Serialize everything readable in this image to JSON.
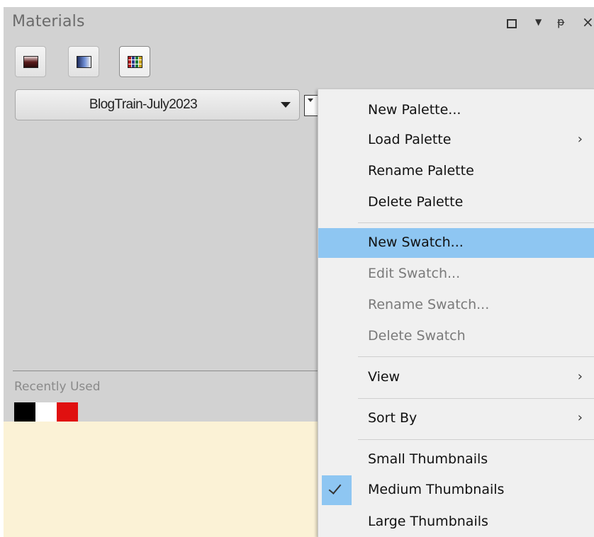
{
  "panel": {
    "title": "Materials",
    "window_controls": {
      "maximize_icon": "square-icon",
      "menu_glyph": "▼",
      "pin_glyph": "ᵽ",
      "close_glyph": "×"
    },
    "toolbar": [
      {
        "name": "gradient",
        "icon": "gradient-icon"
      },
      {
        "name": "pattern",
        "icon": "pattern-icon"
      },
      {
        "name": "swatches",
        "icon": "swatch-grid-icon",
        "selected": true
      }
    ],
    "palette_select": {
      "value": "BlogTrain-July2023"
    },
    "recently_used": {
      "label": "Recently Used",
      "colors": [
        "#000000",
        "#ffffff",
        "#e01010"
      ]
    },
    "background_color": "#d2d2d2",
    "footer_color": "#fbf2d6"
  },
  "context_menu": {
    "highlight_color": "#8ec6f2",
    "items": [
      {
        "label": "New Palette...",
        "submenu": false,
        "disabled": false
      },
      {
        "label": "Load Palette",
        "submenu": true,
        "disabled": false
      },
      {
        "label": "Rename Palette",
        "submenu": false,
        "disabled": false
      },
      {
        "label": "Delete Palette",
        "submenu": false,
        "disabled": false
      },
      {
        "label": "New Swatch...",
        "submenu": false,
        "disabled": false,
        "highlighted": true
      },
      {
        "label": "Edit Swatch...",
        "submenu": false,
        "disabled": true
      },
      {
        "label": "Rename Swatch...",
        "submenu": false,
        "disabled": true
      },
      {
        "label": "Delete Swatch",
        "submenu": false,
        "disabled": true
      },
      {
        "label": "View",
        "submenu": true,
        "disabled": false
      },
      {
        "label": "Sort By",
        "submenu": true,
        "disabled": false
      },
      {
        "label": "Small Thumbnails",
        "submenu": false,
        "disabled": false
      },
      {
        "label": "Medium Thumbnails",
        "submenu": false,
        "disabled": false,
        "checked": true
      },
      {
        "label": "Large Thumbnails",
        "submenu": false,
        "disabled": false
      }
    ],
    "submenu_glyph": "›"
  }
}
